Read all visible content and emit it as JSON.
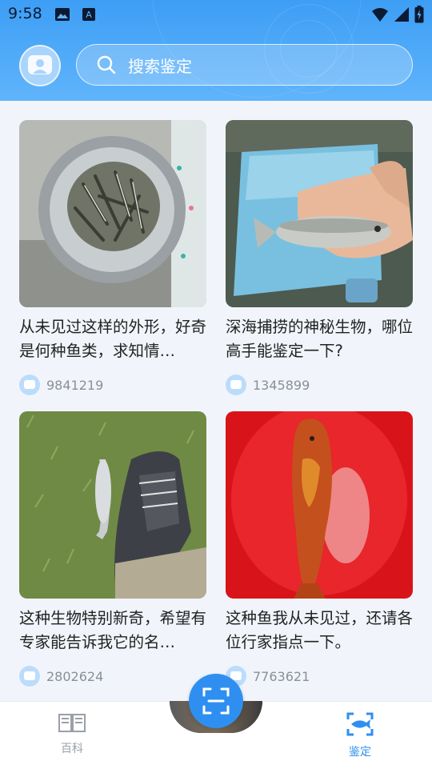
{
  "status_bar": {
    "time": "9:58",
    "icons": [
      "image-icon",
      "a-icon",
      "wifi-icon",
      "signal-icon",
      "battery-icon"
    ]
  },
  "header": {
    "search_placeholder": "搜索鉴定"
  },
  "feed": {
    "posts": [
      {
        "title": "从未见过这样的外形，好奇是何种鱼类，求知情…",
        "count": "9841219",
        "image": "fish-in-bowl"
      },
      {
        "title": "深海捕捞的神秘生物，哪位高手能鉴定一下?",
        "count": "1345899",
        "image": "fish-in-hand"
      },
      {
        "title": "这种生物特别新奇，希望有专家能告诉我它的名…",
        "count": "2802624",
        "image": "fish-on-grass"
      },
      {
        "title": "这种鱼我从未见过，还请各位行家指点一下。",
        "count": "7763621",
        "image": "red-fish-in-tub"
      }
    ]
  },
  "tabbar": {
    "tabs": [
      {
        "label": "百科",
        "icon": "book-icon",
        "active": false
      },
      {
        "label": "鉴定",
        "icon": "fish-scan-icon",
        "active": true
      }
    ],
    "fab_icon": "scan-icon"
  },
  "colors": {
    "accent": "#2f8ff0",
    "header_top": "#3d9ef5",
    "inactive_tab": "#9aa0a8"
  }
}
